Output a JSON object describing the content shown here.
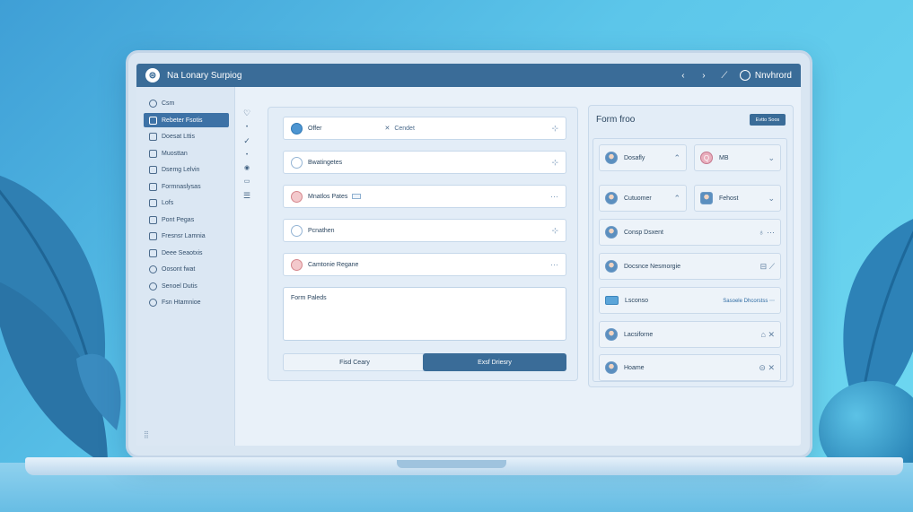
{
  "window": {
    "title": "Na Lonary Surpiog",
    "user_label": "Nnvhrord",
    "controls": [
      "back-icon",
      "forward-icon",
      "pin-icon",
      "user-icon"
    ]
  },
  "sidebar": {
    "items": [
      {
        "label": "Csm",
        "icon": "home-icon",
        "active": false
      },
      {
        "label": "Rebeter Fsotis",
        "icon": "person-icon",
        "active": true
      },
      {
        "label": "Doesat Lttis",
        "icon": "document-icon",
        "active": false
      },
      {
        "label": "Muosttan",
        "icon": "box-icon",
        "active": false
      },
      {
        "label": "Dsemg Lelvin",
        "icon": "folder-icon",
        "active": false
      },
      {
        "label": "Formnaslysas",
        "icon": "form-icon",
        "active": false
      },
      {
        "label": "Lofs",
        "icon": "doc-icon",
        "active": false
      },
      {
        "label": "Pont Pegas",
        "icon": "page-icon",
        "active": false
      },
      {
        "label": "Fresnsr Lamnia",
        "icon": "list-icon",
        "active": false
      },
      {
        "label": "Deee Seaotxis",
        "icon": "table-icon",
        "active": false
      },
      {
        "label": "Oosont fwat",
        "icon": "globe-icon",
        "active": false
      },
      {
        "label": "Senoel Dutis",
        "icon": "settings-icon",
        "active": false
      },
      {
        "label": "Fsn Htamnioe",
        "icon": "help-icon",
        "active": false
      }
    ]
  },
  "form": {
    "rows": [
      {
        "label": "Offer",
        "icon": "blue",
        "mid": "Cendet",
        "action": "⊹"
      },
      {
        "label": "Bwatingetes",
        "icon": "pale",
        "mid": "",
        "action": "⊹"
      },
      {
        "label": "Mnatlos Pates",
        "icon": "red",
        "mid": "",
        "action": "⋯"
      },
      {
        "label": "Pcnathen",
        "icon": "pale",
        "mid": "",
        "action": "⊹"
      },
      {
        "label": "Camtonie Regane",
        "icon": "red",
        "mid": "",
        "action": "⋯"
      }
    ],
    "textarea_label": "Form Paleds",
    "secondary_button": "Fisd Ceary",
    "primary_button": "Exsf Driesry"
  },
  "right_panel": {
    "title": "Form froo",
    "header_button": "Evtto Soos",
    "pairs": [
      {
        "left": "Dosafly",
        "right": "MB",
        "right_initial": "Q"
      },
      {
        "left": "Cutuomer",
        "right": "Fehost"
      }
    ],
    "list": [
      {
        "label": "Consp Dsxent",
        "trail": "♁ ⋯"
      },
      {
        "label": "Docsnce Nesmorgie",
        "trail": "⊟ ⟋"
      },
      {
        "label": "Lsconso",
        "trail": "Sasoele Dhcorstss ⋯"
      },
      {
        "label": "Lacsiforne",
        "trail": "⌂ ✕"
      },
      {
        "label": "Hoame",
        "trail": "⊝ ✕"
      }
    ]
  },
  "colors": {
    "accent": "#3a6c98",
    "background": "#5cc6ea"
  }
}
